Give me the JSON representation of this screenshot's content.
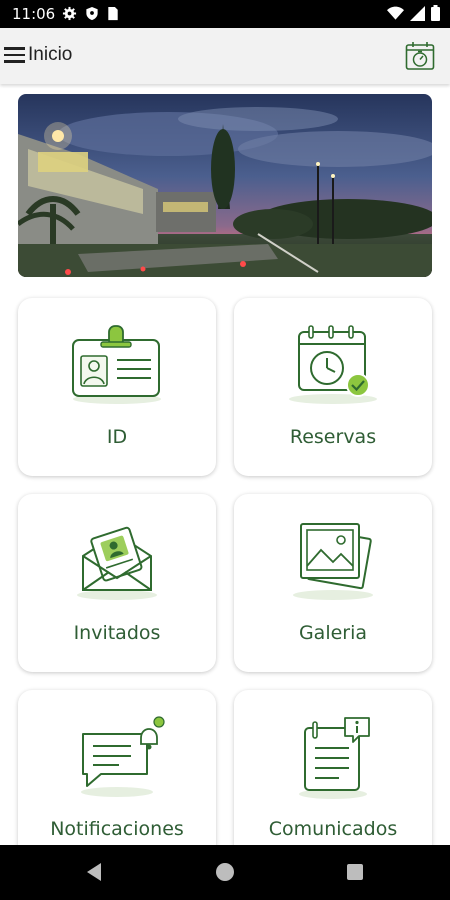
{
  "status_bar": {
    "time": "11:06",
    "icons_left": [
      "gear-icon",
      "shield-icon",
      "sim-card-icon"
    ],
    "icons_right": [
      "wifi-icon",
      "signal-icon",
      "battery-icon"
    ]
  },
  "app_bar": {
    "title": "Inicio",
    "menu_icon": "hamburger-icon",
    "action_icon": "calendar-timer-icon"
  },
  "hero": {
    "description": "campus-night-photo"
  },
  "tiles": [
    {
      "label": "ID",
      "icon": "id-badge-icon"
    },
    {
      "label": "Reservas",
      "icon": "calendar-check-icon"
    },
    {
      "label": "Invitados",
      "icon": "invitation-envelope-icon"
    },
    {
      "label": "Galeria",
      "icon": "photo-gallery-icon"
    },
    {
      "label": "Notificaciones",
      "icon": "notification-chat-icon"
    },
    {
      "label": "Comunicados",
      "icon": "clipboard-info-icon"
    }
  ],
  "nav_bar": {
    "back_icon": "back-triangle-icon",
    "home_icon": "home-circle-icon",
    "recents_icon": "recents-square-icon"
  },
  "colors": {
    "brand_green": "#2f6b2f",
    "accent_lime": "#8cc63f",
    "label_green": "#2f5d35"
  }
}
